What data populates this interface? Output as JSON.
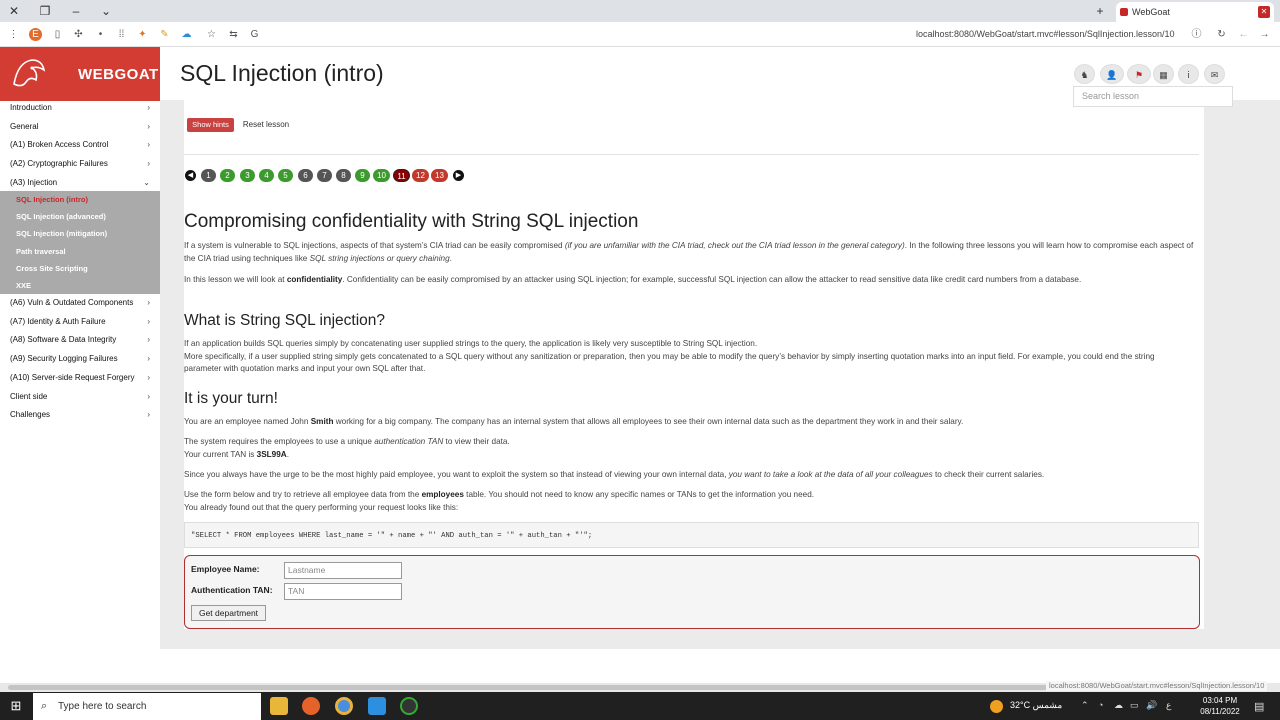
{
  "browser": {
    "tab_title": "WebGoat",
    "url": "localhost:8080/WebGoat/start.mvc#lesson/SqlInjection.lesson/10",
    "status_url": "localhost:8080/WebGoat/start.mvc#lesson/SqlInjection.lesson/10"
  },
  "logo": {
    "text": "WEBGOAT"
  },
  "sidebar": {
    "items": [
      {
        "label": "Introduction"
      },
      {
        "label": "General"
      },
      {
        "label": "(A1) Broken Access Control"
      },
      {
        "label": "(A2) Cryptographic Failures"
      },
      {
        "label": "(A3) Injection"
      }
    ],
    "sub_items": [
      {
        "label": "SQL Injection (intro)",
        "active": true
      },
      {
        "label": "SQL Injection (advanced)"
      },
      {
        "label": "SQL Injection (mitigation)"
      },
      {
        "label": "Path traversal"
      },
      {
        "label": "Cross Site Scripting"
      },
      {
        "label": "XXE"
      }
    ],
    "items_after": [
      {
        "label": "(A6) Vuln & Outdated Components"
      },
      {
        "label": "(A7) Identity & Auth Failure"
      },
      {
        "label": "(A8) Software & Data Integrity"
      },
      {
        "label": "(A9) Security Logging Failures"
      },
      {
        "label": "(A10) Server-side Request Forgery"
      },
      {
        "label": "Client side"
      },
      {
        "label": "Challenges"
      }
    ]
  },
  "header": {
    "title": "SQL Injection (intro)",
    "search_placeholder": "Search lesson"
  },
  "lesson_buttons": {
    "hints": "Show hints",
    "reset": "Reset lesson"
  },
  "pages": [
    "1",
    "2",
    "3",
    "4",
    "5",
    "6",
    "7",
    "8",
    "9",
    "10",
    "11",
    "12",
    "13"
  ],
  "content": {
    "h1": "Compromising confidentiality with String SQL injection",
    "p1a": "If a system is vulnerable to SQL injections, aspects of that system’s CIA triad can be easily compromised ",
    "p1b": "(if you are unfamiliar with the CIA triad, check out the CIA triad lesson in the general category)",
    "p1c": ". In the following three lessons you will learn how to compromise each aspect of the CIA triad using techniques like ",
    "p1d": "SQL string injections or query chaining",
    "p1e": ".",
    "p2a": "In this lesson we will look at ",
    "p2b": "confidentiality",
    "p2c": ". Confidentiality can be easily compromised by an attacker using SQL injection; for example, successful SQL injection can allow the attacker to read sensitive data like credit card numbers from a database.",
    "h2": "What is String SQL injection?",
    "p3a": "If an application builds SQL queries simply by concatenating user supplied strings to the query, the application is likely very susceptible to String SQL injection.",
    "p3b": "More specifically, if a user supplied string simply gets concatenated to a SQL query without any sanitization or preparation, then you may be able to modify the query’s behavior by simply inserting quotation marks into an input field. For example, you could end the string parameter with quotation marks and input your own SQL after that.",
    "h3": "It is your turn!",
    "p4a": "You are an employee named John ",
    "p4b": "Smith",
    "p4c": " working for a big company. The company has an internal system that allows all employees to see their own internal data such as the department they work in and their salary.",
    "p5a": "The system requires the employees to use a unique ",
    "p5b": "authentication TAN",
    "p5c": " to view their data.",
    "p5d": "Your current TAN is ",
    "p5e": "3SL99A",
    "p5f": ".",
    "p6a": "Since you always have the urge to be the most highly paid employee, you want to exploit the system so that instead of viewing your own internal data, ",
    "p6b": "you want to take a look at the data of all your colleagues",
    "p6c": " to check their current salaries.",
    "p7a": "Use the form below and try to retrieve all employee data from the ",
    "p7b": "employees",
    "p7c": " table. You should not need to know any specific names or TANs to get the information you need.",
    "p7d": "You already found out that the query performing your request looks like this:",
    "code": "\"SELECT * FROM employees WHERE last_name = '\" + name + \"' AND auth_tan = '\" + auth_tan + \"'\";"
  },
  "form": {
    "name_label": "Employee Name:",
    "name_placeholder": "Lastname",
    "tan_label": "Authentication TAN:",
    "tan_placeholder": "TAN",
    "submit": "Get department"
  },
  "taskbar": {
    "search_placeholder": "Type here to search",
    "weather": "32°C  مشمس",
    "time": "03:04 PM",
    "date": "08/11/2022",
    "lang": "ع"
  }
}
